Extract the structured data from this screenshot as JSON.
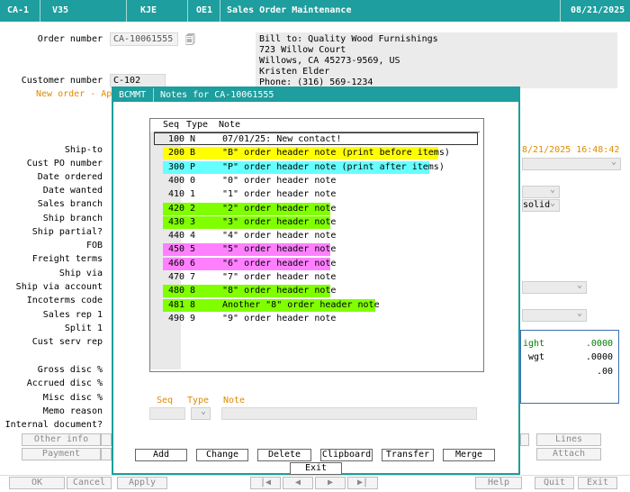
{
  "titlebar": {
    "screen": "CA-1",
    "version": "V35",
    "user": "KJE",
    "program": "OE1",
    "title": "Sales Order Maintenance",
    "date": "08/21/2025"
  },
  "order": {
    "order_number_label": "Order number",
    "order_number": "CA-10061555",
    "customer_number_label": "Customer number",
    "customer_number": "C-102",
    "new_order_text": "New order - Ap",
    "bill_to": [
      "Bill to:   Quality Wood Furnishings",
      "723 Willow Court",
      "Willows, CA    45273-9569, US",
      "Kristen Elder",
      "Phone: (316) 569-1234"
    ],
    "timestamp": "8/21/2025 16:48:42",
    "branch_value": "solid",
    "freight_label": "ight",
    "freight_value": ".0000",
    "wgt_label": "wgt",
    "wgt_value": ".0000",
    "misc_value": ".00"
  },
  "labels": [
    "Ship-to",
    "Cust PO number",
    "Date ordered",
    "Date wanted",
    "Sales branch",
    "Ship branch",
    "Ship partial?",
    "FOB",
    "Freight terms",
    "Ship via",
    "Ship via account",
    "Incoterms code",
    "Sales rep 1",
    "Split 1",
    "Cust serv rep",
    "Gross disc %",
    "Accrued disc %",
    "Misc disc %",
    "Memo reason",
    "Internal document?"
  ],
  "background_buttons": {
    "other_info": "Other info",
    "payment": "Payment",
    "lines": "Lines",
    "attach": "Attach"
  },
  "bottom_bar": {
    "ok": "OK",
    "cancel": "Cancel",
    "apply": "Apply",
    "first": "|◀",
    "prev": "◀",
    "next": "▶",
    "last": "▶|",
    "help": "Help",
    "quit": "Quit",
    "exit": "Exit"
  },
  "modal": {
    "code": "BCMMT",
    "title": "Notes for CA-10061555",
    "columns": {
      "seq": "Seq",
      "type": "Type",
      "note": "Note"
    },
    "rows": [
      {
        "seq": "100",
        "type": "N",
        "note": "07/01/25: New contact!",
        "color": ""
      },
      {
        "seq": "200",
        "type": "B",
        "note": "\"B\" order header note (print before items)",
        "color": "#ffff00"
      },
      {
        "seq": "300",
        "type": "P",
        "note": "\"P\" order header note (print after items)",
        "color": "#66ffff"
      },
      {
        "seq": "400",
        "type": "0",
        "note": "\"0\" order header note",
        "color": ""
      },
      {
        "seq": "410",
        "type": "1",
        "note": "\"1\" order header note",
        "color": ""
      },
      {
        "seq": "420",
        "type": "2",
        "note": "\"2\" order header note",
        "color": "#80ff00"
      },
      {
        "seq": "430",
        "type": "3",
        "note": "\"3\" order header note",
        "color": "#80ff00"
      },
      {
        "seq": "440",
        "type": "4",
        "note": "\"4\" order header note",
        "color": ""
      },
      {
        "seq": "450",
        "type": "5",
        "note": "\"5\" order header note",
        "color": "#ff80ff"
      },
      {
        "seq": "460",
        "type": "6",
        "note": "\"6\" order header note",
        "color": "#ff80ff"
      },
      {
        "seq": "470",
        "type": "7",
        "note": "\"7\" order header note",
        "color": ""
      },
      {
        "seq": "480",
        "type": "8",
        "note": "\"8\" order header note",
        "color": "#80ff00"
      },
      {
        "seq": "481",
        "type": "8",
        "note": "Another \"8\" order header note",
        "color": "#80ff00"
      },
      {
        "seq": "490",
        "type": "9",
        "note": "\"9\" order header note",
        "color": ""
      }
    ],
    "edit_labels": {
      "seq": "Seq",
      "type": "Type",
      "note": "Note"
    },
    "buttons": {
      "add": "Add",
      "change": "Change",
      "delete": "Delete",
      "clipboard": "Clipboard",
      "transfer": "Transfer",
      "merge": "Merge",
      "exit": "Exit"
    }
  },
  "colors": {
    "titlebar": "#1e9e9e",
    "accent_orange": "#e08a00",
    "freight_green": "#008000"
  }
}
